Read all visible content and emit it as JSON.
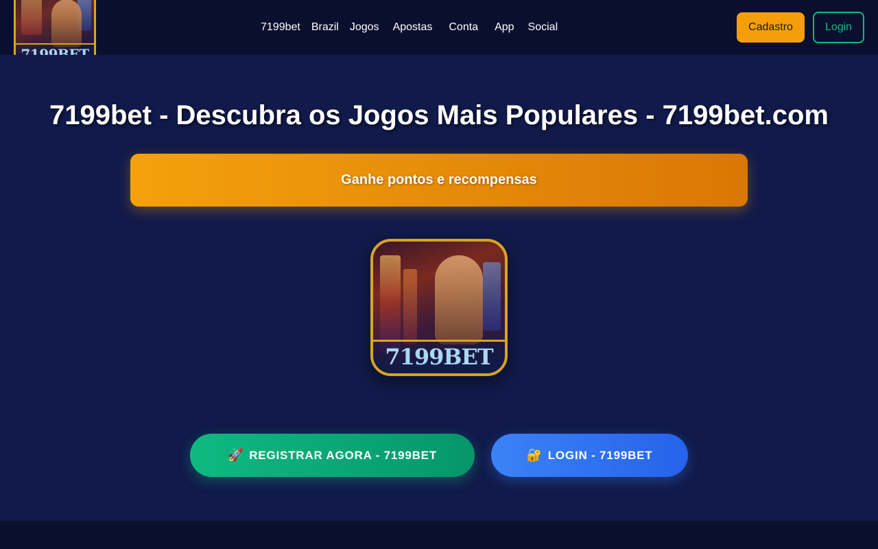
{
  "header": {
    "logo_text": "7199BET",
    "nav": [
      "7199bet",
      "Brazil",
      "Jogos",
      "Apostas",
      "Conta",
      "App",
      "Social"
    ],
    "cadastro_label": "Cadastro",
    "login_label": "Login"
  },
  "hero": {
    "title": "7199bet - Descubra os Jogos Mais Populares - 7199bet.com",
    "banner_text": "Ganhe pontos e recompensas",
    "image_brand": "7199BET"
  },
  "cta": {
    "register_icon": "🚀",
    "register_label": "REGISTRAR AGORA - 7199BET",
    "login_icon": "🔐",
    "login_label": "LOGIN - 7199BET"
  },
  "colors": {
    "background": "#111a4a",
    "header": "#0a0f2e",
    "accent_orange": "#f59e0b",
    "accent_green": "#10b981",
    "accent_blue": "#3b82f6",
    "gold_border": "#d9a421"
  }
}
